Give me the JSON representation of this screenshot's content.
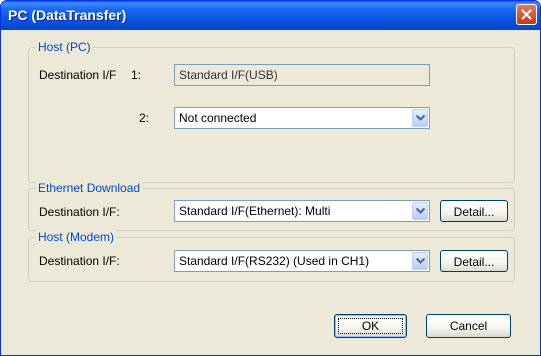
{
  "window": {
    "title": "PC (DataTransfer)"
  },
  "host_pc": {
    "legend": "Host (PC)",
    "dest_label": "Destination I/F",
    "index1": "1:",
    "if1_value": "Standard I/F(USB)",
    "index2": "2:",
    "if2_value": "Not connected"
  },
  "ethernet": {
    "legend": "Ethernet Download",
    "dest_label": "Destination I/F:",
    "value": "Standard I/F(Ethernet): Multi",
    "detail_label": "Detail..."
  },
  "modem": {
    "legend": "Host (Modem)",
    "dest_label": "Destination I/F:",
    "value": "Standard I/F(RS232) (Used in CH1)",
    "detail_label": "Detail..."
  },
  "buttons": {
    "ok": "OK",
    "cancel": "Cancel"
  }
}
